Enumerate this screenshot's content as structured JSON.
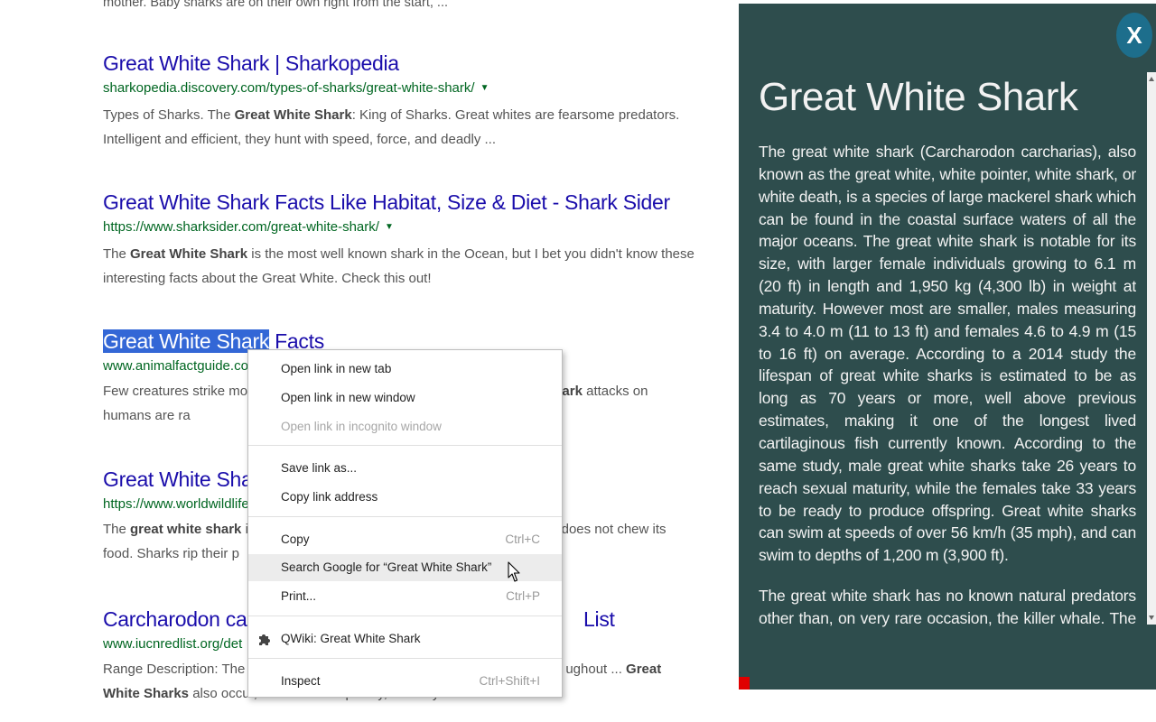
{
  "top_snippet": "mother. Baby sharks are on their own right from the start, ...",
  "results": [
    {
      "title": "Great White Shark | Sharkopedia",
      "url": "sharkopedia.discovery.com/types-of-sharks/great-white-shark/",
      "snippet_html": "Types of Sharks. The <b>Great White Shark</b>: King of Sharks. Great whites are fearsome predators. Intelligent and efficient, they hunt with speed, force, and deadly ..."
    },
    {
      "title": "Great White Shark Facts Like Habitat, Size & Diet - Shark Sider",
      "url": "https://www.sharksider.com/great-white-shark/",
      "snippet_html": "The <b>Great White Shark</b> is the most well known shark in the Ocean, but I bet you didn't know these interesting facts about the Great White. Check this out!"
    },
    {
      "title_selected": "Great White Shark",
      "title_rest": " Facts",
      "url": "www.animalfactguide.co",
      "snippet_html": "Few creatures strike more <span style=\"display:inline-block;width:230px\"></span><b>great white shark</b> attacks on humans are ra"
    },
    {
      "title": "Great White Shark",
      "url": "https://www.worldwildlife",
      "snippet_html": "The <b>great white shark</b> is <span style=\"display:inline-block;width:290px\"></span>th, yet does not chew its food. Sharks rip their p"
    },
    {
      "title": "Carcharodon carc",
      "title_tail": "List",
      "url": "www.iucnredlist.org/det",
      "snippet_html": "Range Description: The <b>C</b><span style=\"display:inline-block;width:340px\"></span>ughout ... <b>Great White Sharks</b> also occur, albeit less frequently, at many sites ..."
    }
  ],
  "context_menu": {
    "items": [
      {
        "label": "Open link in new tab",
        "shortcut": ""
      },
      {
        "label": "Open link in new window",
        "shortcut": ""
      },
      {
        "label": "Open link in incognito window",
        "shortcut": "",
        "disabled": true
      },
      {
        "label": "Save link as...",
        "shortcut": ""
      },
      {
        "label": "Copy link address",
        "shortcut": ""
      },
      {
        "label": "Copy",
        "shortcut": "Ctrl+C"
      },
      {
        "label": "Search Google for “Great White Shark”",
        "shortcut": ""
      },
      {
        "label": "Print...",
        "shortcut": "Ctrl+P"
      },
      {
        "label": "QWiki: Great White Shark",
        "shortcut": ""
      },
      {
        "label": "Inspect",
        "shortcut": "Ctrl+Shift+I"
      }
    ]
  },
  "panel": {
    "title": "Great White Shark",
    "close_label": "X",
    "paragraphs": [
      "The great white shark (Carcharodon carcharias), also known as the great white, white pointer, white shark, or white death, is a species of large mackerel shark which can be found in the coastal surface waters of all the major oceans. The great white shark is notable for its size, with larger female individuals growing to 6.1 m (20 ft) in length and 1,950 kg (4,300 lb) in weight at maturity. However most are smaller, males measuring 3.4 to 4.0 m (11 to 13 ft) and females 4.6 to 4.9 m (15 to 16 ft) on average. According to a 2014 study the lifespan of great white sharks is estimated to be as long as 70 years or more, well above previous estimates, making it one of the longest lived cartilaginous fish currently known. According to the same study, male great white sharks take 26 years to reach sexual maturity, while the females take 33 years to be ready to produce offspring. Great white sharks can swim at speeds of over 56 km/h (35 mph), and can swim to depths of 1,200 m (3,900 ft).",
      "The great white shark has no known natural predators other than, on very rare occasion, the killer whale. The great white shark is arguably the world's largest known extant macropredatory fish, and is one of the primary predators of"
    ]
  },
  "colors": {
    "link": "#1a0dab",
    "url": "#006621",
    "panel_bg": "#2e4d4d",
    "close_btn": "#1d6e8c",
    "selection": "#3367d6"
  }
}
